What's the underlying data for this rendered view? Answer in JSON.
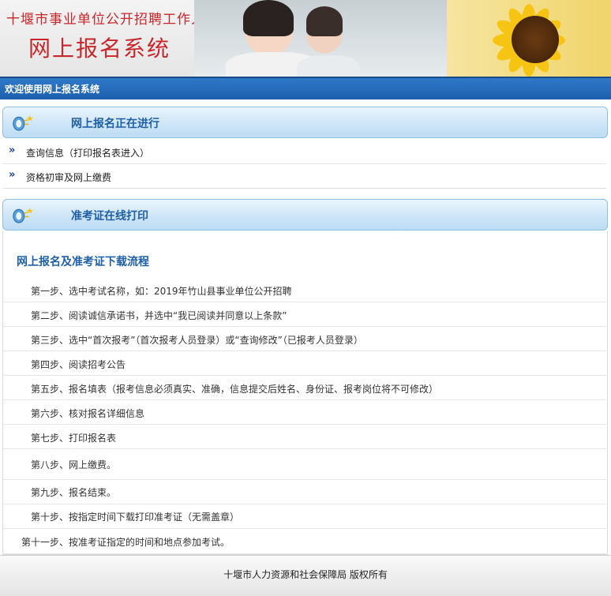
{
  "banner": {
    "line1": "十堰市事业单位公开招聘工作人员",
    "line2": "网上报名系统"
  },
  "welcome": "欢迎使用网上报名系统",
  "sections": {
    "online_registration": "网上报名正在进行",
    "admission_print": "准考证在线打印"
  },
  "links": [
    {
      "arrow": "»",
      "label": "查询信息（打印报名表进入）"
    },
    {
      "arrow": "»",
      "label": "资格初审及网上缴费"
    }
  ],
  "process": {
    "title": "网上报名及准考证下载流程",
    "steps": [
      "第一步、选中考试名称，如：2019年竹山县事业单位公开招聘",
      "第二步、阅读诚信承诺书，并选中“我已阅读并同意以上条款”",
      "第三步、选中“首次报考”（首次报考人员登录）或“查询修改”（已报考人员登录）",
      "第四步、阅读招考公告",
      "第五步、报名填表（报考信息必须真实、准确，信息提交后姓名、身份证、报考岗位将不可修改）",
      "第六步、核对报名详细信息",
      "第七步、打印报名表",
      "第八步、网上缴费。",
      "第九步、报名结束。",
      "第十步、按指定时间下载打印准考证（无需盖章）",
      "第十一步、按准考证指定的时间和地点参加考试。"
    ]
  },
  "footer": "十堰市人力资源和社会保障局 版权所有",
  "colors": {
    "accent": "#1f5fa6",
    "banner_red": "#c8262a",
    "welcome_bar": "#1d5fae"
  }
}
